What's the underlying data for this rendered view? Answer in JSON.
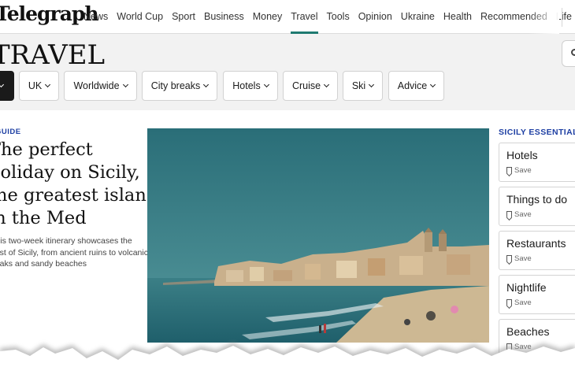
{
  "header": {
    "logo_text": "Telegraph",
    "nav": [
      {
        "label": "News",
        "active": false
      },
      {
        "label": "World Cup",
        "active": false
      },
      {
        "label": "Sport",
        "active": false
      },
      {
        "label": "Business",
        "active": false
      },
      {
        "label": "Money",
        "active": false
      },
      {
        "label": "Travel",
        "active": true
      },
      {
        "label": "Tools",
        "active": false
      },
      {
        "label": "Opinion",
        "active": false
      },
      {
        "label": "Ukraine",
        "active": false
      },
      {
        "label": "Health",
        "active": false
      },
      {
        "label": "Recommended",
        "active": false
      },
      {
        "label": "Life",
        "active": false
      }
    ],
    "accent_color": "#1f7a70"
  },
  "section": {
    "title": "TRAVEL",
    "search_icon": "search-icon",
    "chips": [
      {
        "label": "",
        "style": "dark"
      },
      {
        "label": "UK"
      },
      {
        "label": "Worldwide"
      },
      {
        "label": "City breaks"
      },
      {
        "label": "Hotels"
      },
      {
        "label": "Cruise"
      },
      {
        "label": "Ski"
      },
      {
        "label": "Advice"
      }
    ]
  },
  "article": {
    "kicker": "GUIDE",
    "headline_lines": [
      "The perfect",
      "holiday on Sicily,",
      "the greatest island",
      "in the Med"
    ],
    "standfirst_lines": [
      "This two-week itinerary showcases the",
      "best of Sicily, from ancient ruins to volcanic",
      "peaks and sandy beaches"
    ],
    "kicker_color": "#1e3fa3"
  },
  "sidebar": {
    "heading": "SICILY ESSENTIALS",
    "save_label": "Save",
    "cards": [
      {
        "title": "Hotels"
      },
      {
        "title": "Things to do"
      },
      {
        "title": "Restaurants"
      },
      {
        "title": "Nightlife"
      },
      {
        "title": "Beaches"
      }
    ]
  }
}
